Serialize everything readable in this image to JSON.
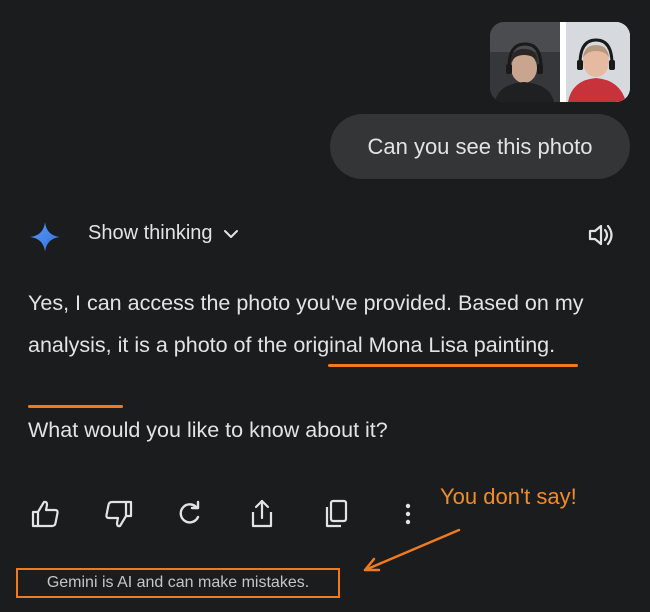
{
  "colors": {
    "background": "#1b1c1d",
    "bubble": "#333537",
    "text": "#e3e3e3",
    "annotation": "#f07b1e",
    "gemini_spark": "#4f8df5"
  },
  "user_message": {
    "text": "Can you see this photo",
    "attachment_icon": "photo-thumbnail"
  },
  "response_header": {
    "show_thinking_label": "Show thinking",
    "expand_icon": "chevron-down-icon",
    "read_aloud_icon": "speaker-icon"
  },
  "response": {
    "part1": "Yes, I can access the photo you've provided. Based on my analysis, it is a photo of ",
    "highlight": "the original Mona Lisa painting",
    "part2": ".",
    "question": "What would you like to know about it?"
  },
  "actions": [
    {
      "name": "thumbs-up-icon"
    },
    {
      "name": "thumbs-down-icon"
    },
    {
      "name": "regenerate-icon"
    },
    {
      "name": "share-icon"
    },
    {
      "name": "copy-icon"
    },
    {
      "name": "more-vertical-icon"
    }
  ],
  "annotation": {
    "text": "You don't say!"
  },
  "disclaimer": "Gemini is AI and can make mistakes."
}
